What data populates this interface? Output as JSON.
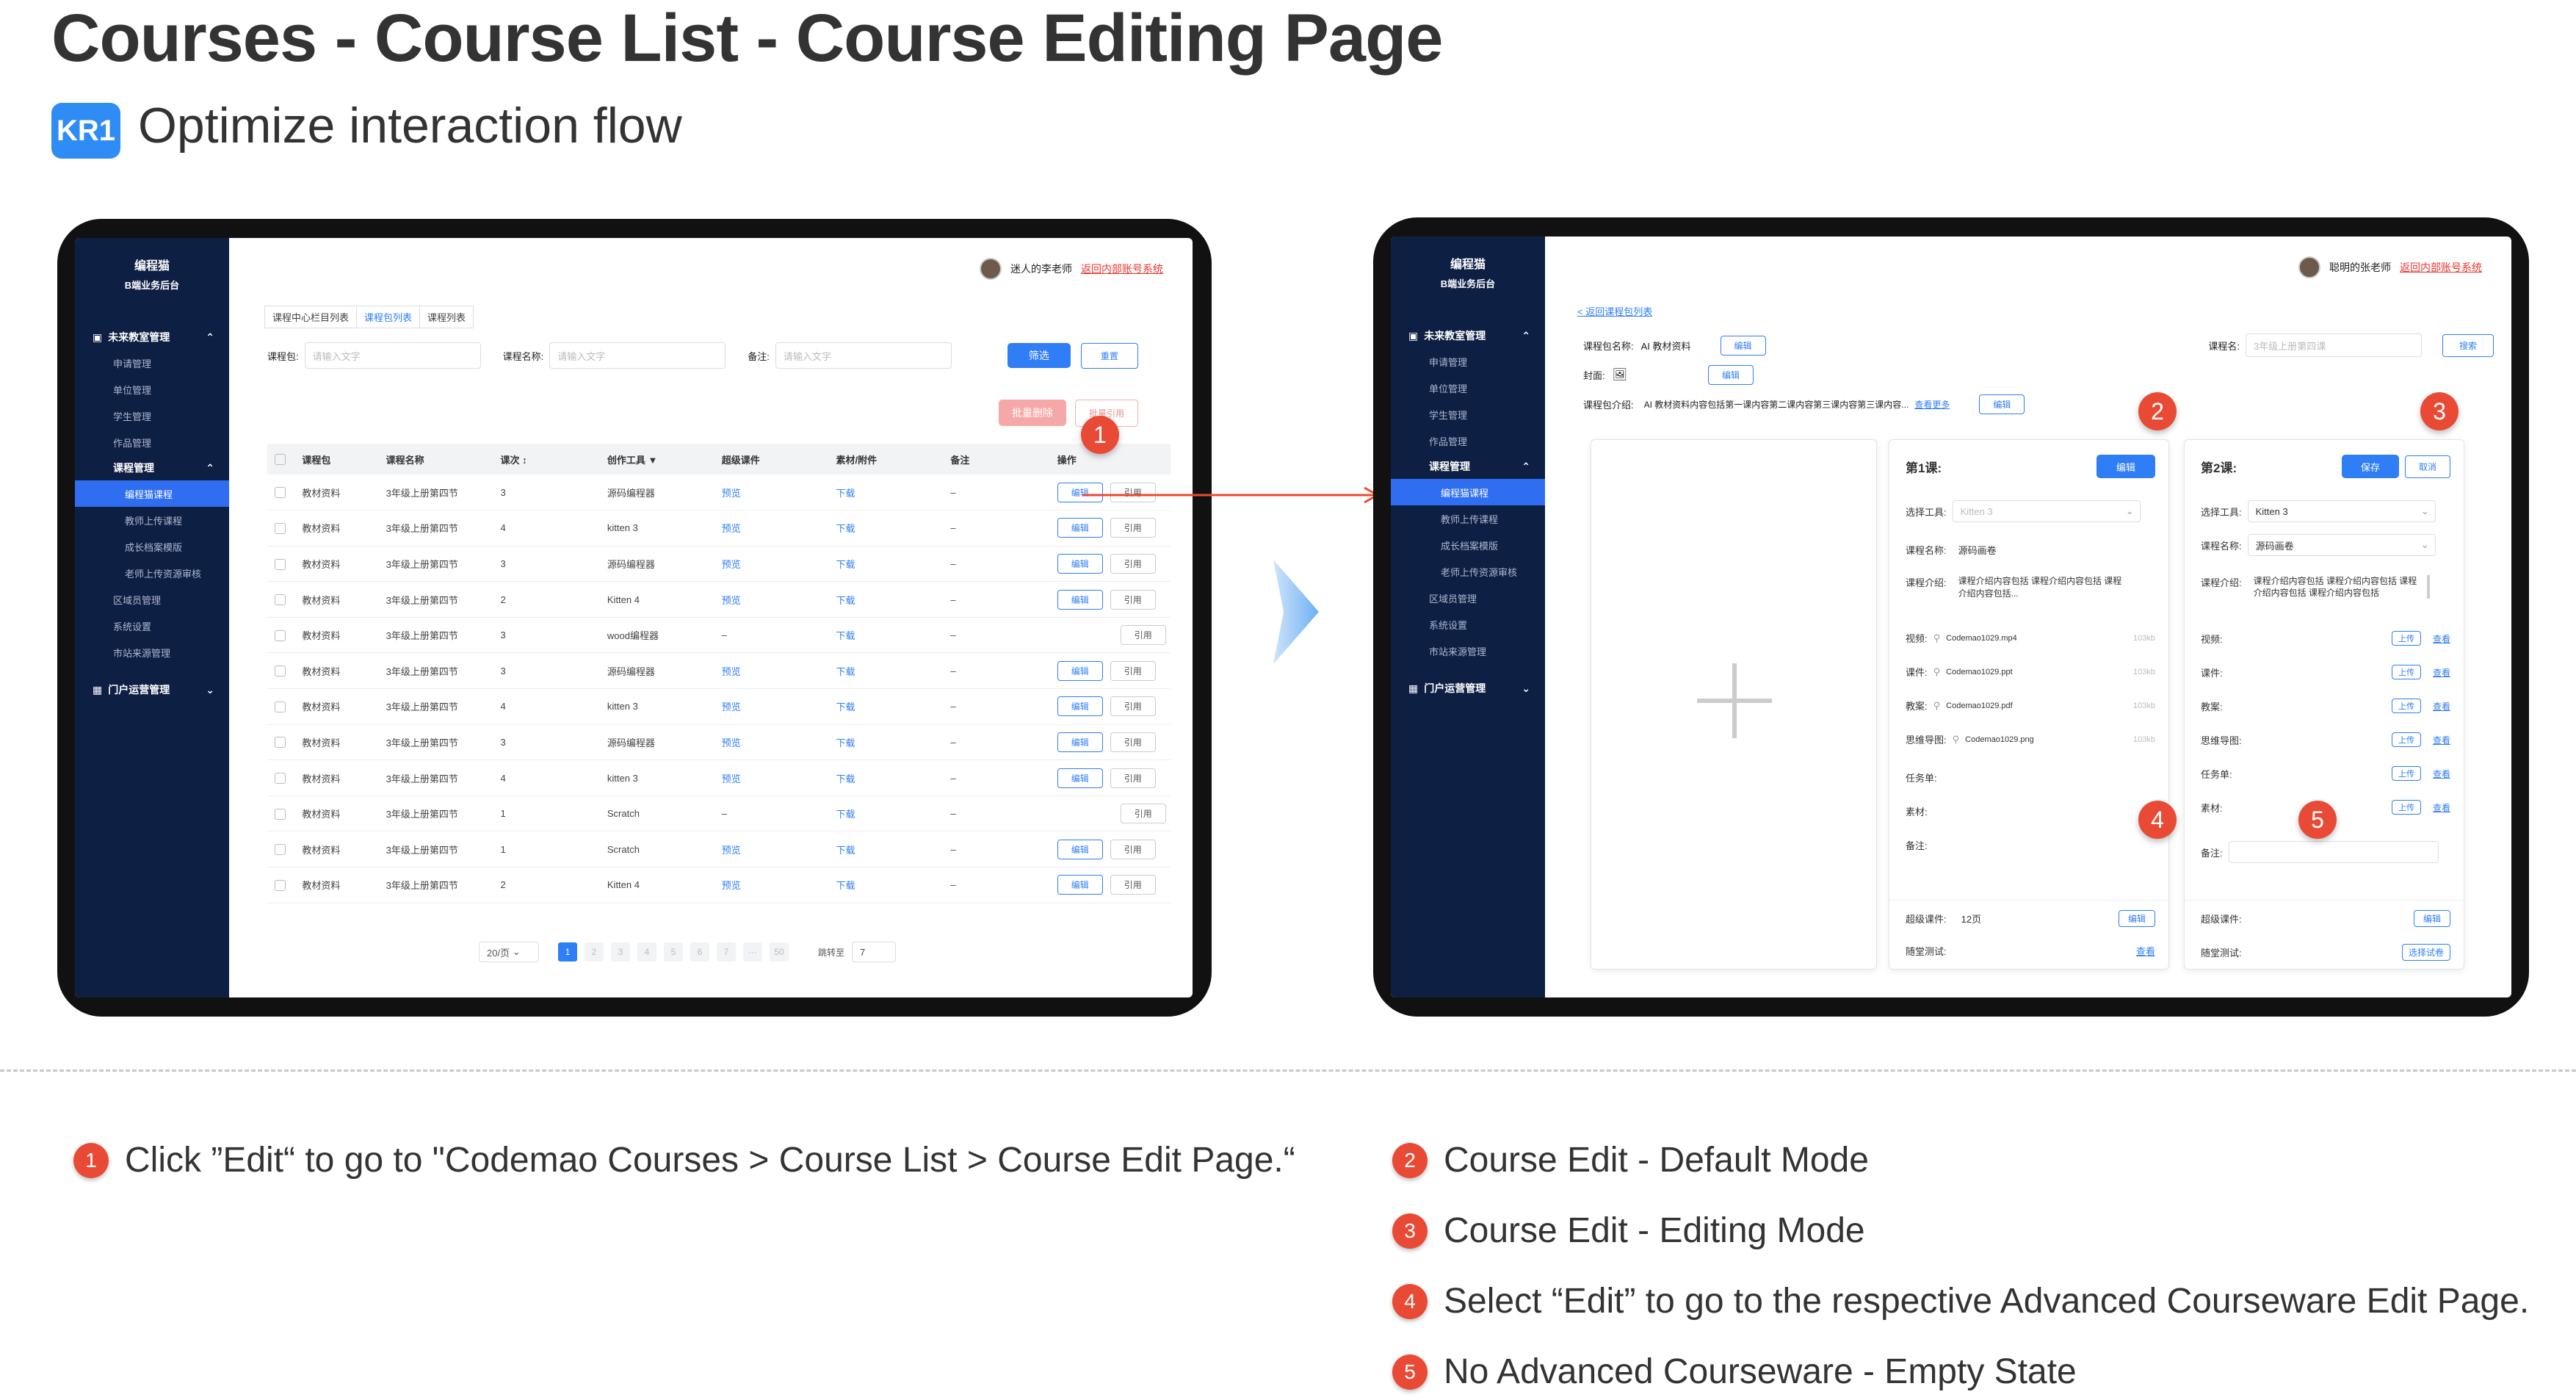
{
  "header": {
    "title": "Courses - Course List - Course Editing Page",
    "kr_badge": "KR1",
    "subtitle": "Optimize interaction flow"
  },
  "colors": {
    "accent": "#2f7ef5",
    "sidebar": "#0e1f44",
    "callout": "#e94a35",
    "kr_badge": "#2f8cf5"
  },
  "sidebar": {
    "brand_line1": "编程猫",
    "brand_line2": "B端业务后台",
    "group_classroom": "未来教室管理",
    "items_top": [
      "申请管理",
      "单位管理",
      "学生管理",
      "作品管理"
    ],
    "group_course": "课程管理",
    "items_course": [
      "编程猫课程",
      "教师上传课程",
      "成长档案模版",
      "老师上传资源审核"
    ],
    "items_bottom": [
      "区域员管理",
      "系统设置",
      "市站来源管理"
    ],
    "group_portal": "门户运营管理"
  },
  "screen1": {
    "user_name": "迷人的李老师",
    "back_link": "返回内部账号系统",
    "tabs": [
      "课程中心栏目列表",
      "课程包列表",
      "课程列表"
    ],
    "filters": {
      "package_label": "课程包:",
      "name_label": "课程名称:",
      "remark_label": "备注:",
      "placeholder": "请输入文字"
    },
    "filter_btn": "筛选",
    "reset_btn": "重置",
    "batch_delete_btn": "批量删除",
    "batch_ref_btn": "批量引用",
    "columns": [
      "课程包",
      "课程名称",
      "课次 ↕",
      "创作工具 ▼",
      "超级课件",
      "素材/附件",
      "备注",
      "操作"
    ],
    "rows": [
      {
        "pkg": "教材资料",
        "name": "3年级上册第四节",
        "lesson": "3",
        "tool": "源码编程器",
        "courseware": "预览",
        "attach": "下载",
        "remark": "–",
        "edit": "编辑",
        "ref": "引用"
      },
      {
        "pkg": "教材资料",
        "name": "3年级上册第四节",
        "lesson": "4",
        "tool": "kitten 3",
        "courseware": "预览",
        "attach": "下载",
        "remark": "–",
        "edit": "编辑",
        "ref": "引用"
      },
      {
        "pkg": "教材资料",
        "name": "3年级上册第四节",
        "lesson": "3",
        "tool": "源码编程器",
        "courseware": "预览",
        "attach": "下载",
        "remark": "–",
        "edit": "编辑",
        "ref": "引用"
      },
      {
        "pkg": "教材资料",
        "name": "3年级上册第四节",
        "lesson": "2",
        "tool": "Kitten 4",
        "courseware": "预览",
        "attach": "下载",
        "remark": "–",
        "edit": "编辑",
        "ref": "引用"
      },
      {
        "pkg": "教材资料",
        "name": "3年级上册第四节",
        "lesson": "3",
        "tool": "wood编程器",
        "courseware": "–",
        "attach": "下载",
        "remark": "–",
        "edit": "",
        "ref": "引用"
      },
      {
        "pkg": "教材资料",
        "name": "3年级上册第四节",
        "lesson": "3",
        "tool": "源码编程器",
        "courseware": "预览",
        "attach": "下载",
        "remark": "–",
        "edit": "编辑",
        "ref": "引用"
      },
      {
        "pkg": "教材资料",
        "name": "3年级上册第四节",
        "lesson": "4",
        "tool": "kitten 3",
        "courseware": "预览",
        "attach": "下载",
        "remark": "–",
        "edit": "编辑",
        "ref": "引用"
      },
      {
        "pkg": "教材资料",
        "name": "3年级上册第四节",
        "lesson": "3",
        "tool": "源码编程器",
        "courseware": "预览",
        "attach": "下载",
        "remark": "–",
        "edit": "编辑",
        "ref": "引用"
      },
      {
        "pkg": "教材资料",
        "name": "3年级上册第四节",
        "lesson": "4",
        "tool": "kitten 3",
        "courseware": "预览",
        "attach": "下载",
        "remark": "–",
        "edit": "编辑",
        "ref": "引用"
      },
      {
        "pkg": "教材资料",
        "name": "3年级上册第四节",
        "lesson": "1",
        "tool": "Scratch",
        "courseware": "–",
        "attach": "下载",
        "remark": "–",
        "edit": "",
        "ref": "引用"
      },
      {
        "pkg": "教材资料",
        "name": "3年级上册第四节",
        "lesson": "1",
        "tool": "Scratch",
        "courseware": "预览",
        "attach": "下载",
        "remark": "–",
        "edit": "编辑",
        "ref": "引用"
      },
      {
        "pkg": "教材资料",
        "name": "3年级上册第四节",
        "lesson": "2",
        "tool": "Kitten 4",
        "courseware": "预览",
        "attach": "下载",
        "remark": "–",
        "edit": "编辑",
        "ref": "引用"
      }
    ],
    "pagination": {
      "page_size": "20/页",
      "pages": [
        "1",
        "2",
        "3",
        "4",
        "5",
        "6",
        "7",
        "···",
        "50"
      ],
      "jump_label": "跳转至",
      "jump_value": "7"
    }
  },
  "screen2": {
    "user_name": "聪明的张老师",
    "back_link": "返回内部账号系统",
    "back_to_list": "< 返回课程包列表",
    "pkg_name_label": "课程包名称:",
    "pkg_name_value": "AI 教材资料",
    "edit_btn": "编辑",
    "cover_label": "封面:",
    "intro_label": "课程包介绍:",
    "intro_value": "AI 教材资料内容包括第一课内容第二课内容第三课内容第三课内容...",
    "more_link": "查看更多",
    "course_name_label": "课程名:",
    "course_name_placeholder": "3年级上册第四课",
    "search_btn": "搜索",
    "lesson1": {
      "title": "第1课:",
      "edit_btn": "编辑",
      "tool_label": "选择工具:",
      "tool_value": "Kitten 3",
      "name_label": "课程名称:",
      "name_value": "源码画卷",
      "intro_label": "课程介绍:",
      "intro_value": "课程介绍内容包括 课程介绍内容包括 课程介绍内容包括...",
      "files": [
        {
          "label": "视频:",
          "name": "Codemao1029.mp4",
          "size": "103kb"
        },
        {
          "label": "课件:",
          "name": "Codemao1029.ppt",
          "size": "103kb"
        },
        {
          "label": "教案:",
          "name": "Codemao1029.pdf",
          "size": "103kb"
        },
        {
          "label": "思维导图:",
          "name": "Codemao1029.png",
          "size": "103kb"
        }
      ],
      "task_label": "任务单:",
      "material_label": "素材:",
      "remark_label": "备注:",
      "courseware_label": "超级课件:",
      "courseware_value": "12页",
      "courseware_edit": "编辑",
      "quiz_label": "随堂测试:",
      "quiz_link": "查看"
    },
    "lesson2": {
      "title": "第2课:",
      "save_btn": "保存",
      "cancel_btn": "取消",
      "tool_label": "选择工具:",
      "tool_value": "Kitten 3",
      "name_label": "课程名称:",
      "name_value": "源码画卷",
      "intro_label": "课程介绍:",
      "intro_value": "课程介绍内容包括 课程介绍内容包括 课程介绍内容包括 课程介绍内容包括",
      "upload_rows": [
        "视频:",
        "课件:",
        "教案:",
        "思维导图:",
        "任务单:",
        "素材:"
      ],
      "upload_btn": "上传",
      "view_link": "查看",
      "remark_label": "备注:",
      "courseware_label": "超级课件:",
      "courseware_edit": "编辑",
      "quiz_label": "随堂测试:",
      "quiz_btn": "选择试卷"
    }
  },
  "callouts": [
    "1",
    "2",
    "3",
    "4",
    "5"
  ],
  "legend": [
    {
      "num": "1",
      "text": "Click ”Edit“ to go to \"Codemao Courses > Course List > Course Edit Page.“"
    },
    {
      "num": "2",
      "text": "Course Edit - Default Mode"
    },
    {
      "num": "3",
      "text": "Course Edit - Editing Mode"
    },
    {
      "num": "4",
      "text": "Select “Edit” to go to the respective Advanced Courseware Edit Page."
    },
    {
      "num": "5",
      "text": "No Advanced Courseware - Empty State"
    }
  ]
}
